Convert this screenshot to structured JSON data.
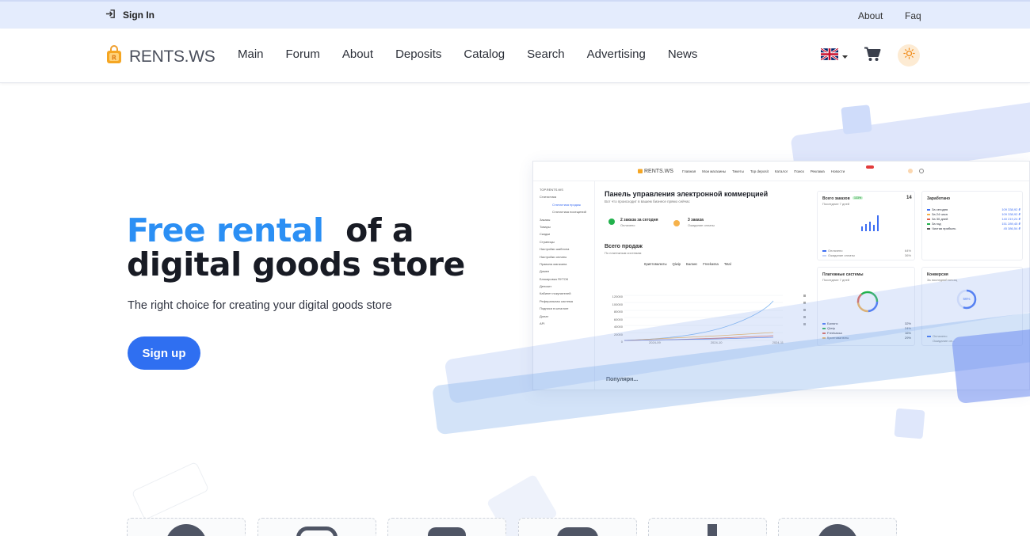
{
  "topbar": {
    "signin_label": "Sign In",
    "about_label": "About",
    "faq_label": "Faq"
  },
  "header": {
    "logo_text": "RENTS.WS",
    "nav": [
      "Main",
      "Forum",
      "About",
      "Deposits",
      "Catalog",
      "Search",
      "Advertising",
      "News"
    ],
    "language": "en-flag-icon"
  },
  "hero": {
    "title_accent": "Free rental",
    "title_line1_rest": "of a",
    "title_line2": "digital goods store",
    "subtitle": "The right choice for creating your digital goods store",
    "cta_label": "Sign up"
  },
  "dashboard_preview": {
    "logo": "RENTS.WS",
    "nav": [
      "Главная",
      "Мои магазины",
      "Тикеты",
      "Top deposit",
      "Каталог",
      "Поиск",
      "Реклама",
      "Новости"
    ],
    "sidebar": [
      "TOP.RENTS.WS",
      "Статистика",
      "Статистика продаж",
      "Статистика посещений",
      "Заказы",
      "Товары",
      "Скидки",
      "Страницы",
      "Настройки шаблона",
      "Настройки оплаты",
      "Правила магазина",
      "Домен",
      "Блокировка ЯУТОК",
      "Депозит",
      "Кабинет покупателей",
      "Реферальная система",
      "Подписи в каталоге",
      "Донат",
      "API"
    ],
    "title": "Панель управления электронной коммерцией",
    "subtitle": "Вот что происходит в вашем бизнесе прямо сейчас",
    "orders_today": "2 заказа за сегодня",
    "orders_today_sub": "Оплачено",
    "orders_pending": "3 заказа",
    "orders_pending_sub": "Ожидание оплаты",
    "sales_title": "Всего продаж",
    "sales_sub": "По платежным системам",
    "legend": [
      "Криптовалюты",
      "Qiwip",
      "Баланс",
      "Freekassa",
      "Total"
    ],
    "y_ticks": [
      "120000",
      "100000",
      "80000",
      "60000",
      "40000",
      "20000",
      "0"
    ],
    "x_ticks": [
      "2024-09",
      "2024-10",
      "2024-11"
    ],
    "popular": "Популярн...",
    "total_orders_label": "Всего заказов",
    "total_orders_badge": "133%",
    "total_orders_value": "14",
    "total_orders_sub": "Последние 7 дней",
    "paid_label": "Оплачено",
    "paid_pct": "64%",
    "waiting_label": "Ожидание оплаты",
    "waiting_pct": "36%",
    "earned_title": "Заработано",
    "earned_rows": [
      {
        "label": "За сегодня",
        "value": "109 338,92 ₽"
      },
      {
        "label": "За 24 часа",
        "value": "109 338,92 ₽"
      },
      {
        "label": "За 30 дней",
        "value": "140 219,24 ₽"
      },
      {
        "label": "За год",
        "value": "151 289,45 ₽"
      },
      {
        "label": "Чистая прибыль",
        "value": "45 386,54 ₽"
      }
    ],
    "pay_systems_title": "Платежные системы",
    "pay_systems_sub": "Последние 7 дней",
    "pay_rows": [
      {
        "label": "Баланс",
        "pct": "32%"
      },
      {
        "label": "Qiwip",
        "pct": "24%"
      },
      {
        "label": "Freekassa",
        "pct": "16%"
      },
      {
        "label": "Криптовалюты",
        "pct": "29%"
      }
    ],
    "conversion_title": "Конверсия",
    "conversion_sub": "За последний месяц",
    "conversion_value": "56%",
    "conv_paid": "Оплачено",
    "conv_waiting": "Ожидание оп..."
  },
  "colors": {
    "accent": "#2b8ff4",
    "button": "#2f6ff1",
    "topbar_bg": "#e4ecfd"
  }
}
